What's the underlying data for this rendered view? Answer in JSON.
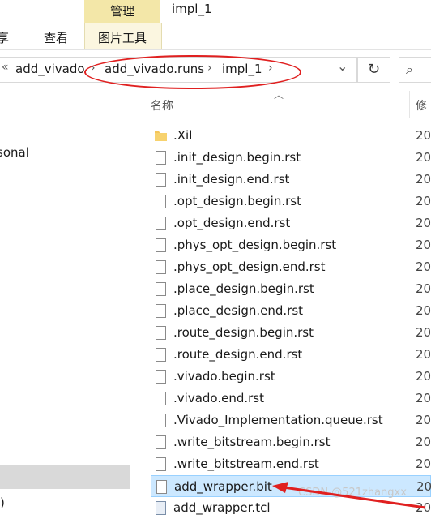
{
  "ribbon": {
    "context_tab": "管理",
    "window_title": "impl_1",
    "tabs": [
      "享",
      "查看",
      "图片工具"
    ]
  },
  "address": {
    "overflow": "«",
    "crumbs": [
      "add_vivado",
      "add_vivado.runs",
      "impl_1"
    ],
    "chevron": "›",
    "dropdown": "⌄",
    "refresh": "↻",
    "search": "⌕"
  },
  "nav": {
    "items": [
      "sonal",
      ")"
    ]
  },
  "list": {
    "name_header": "名称",
    "modified_header": "修",
    "rows": [
      {
        "name": ".Xil",
        "type": "folder",
        "date": "20"
      },
      {
        "name": ".init_design.begin.rst",
        "type": "file",
        "date": "20"
      },
      {
        "name": ".init_design.end.rst",
        "type": "file",
        "date": "20"
      },
      {
        "name": ".opt_design.begin.rst",
        "type": "file",
        "date": "20"
      },
      {
        "name": ".opt_design.end.rst",
        "type": "file",
        "date": "20"
      },
      {
        "name": ".phys_opt_design.begin.rst",
        "type": "file",
        "date": "20"
      },
      {
        "name": ".phys_opt_design.end.rst",
        "type": "file",
        "date": "20"
      },
      {
        "name": ".place_design.begin.rst",
        "type": "file",
        "date": "20"
      },
      {
        "name": ".place_design.end.rst",
        "type": "file",
        "date": "20"
      },
      {
        "name": ".route_design.begin.rst",
        "type": "file",
        "date": "20"
      },
      {
        "name": ".route_design.end.rst",
        "type": "file",
        "date": "20"
      },
      {
        "name": ".vivado.begin.rst",
        "type": "file",
        "date": "20"
      },
      {
        "name": ".vivado.end.rst",
        "type": "file",
        "date": "20"
      },
      {
        "name": ".Vivado_Implementation.queue.rst",
        "type": "file",
        "date": "20"
      },
      {
        "name": ".write_bitstream.begin.rst",
        "type": "file",
        "date": "20"
      },
      {
        "name": ".write_bitstream.end.rst",
        "type": "file",
        "date": "20"
      },
      {
        "name": "add_wrapper.bit",
        "type": "file",
        "date": "20",
        "selected": true
      },
      {
        "name": "add_wrapper.tcl",
        "type": "tcl",
        "date": "20"
      }
    ]
  },
  "watermark": "CSDN @521zhangxx",
  "colors": {
    "context_tab": "#f3e7a8",
    "selection": "#cce8ff",
    "annotation_red": "#e02020",
    "folder": "#f4c55a"
  }
}
